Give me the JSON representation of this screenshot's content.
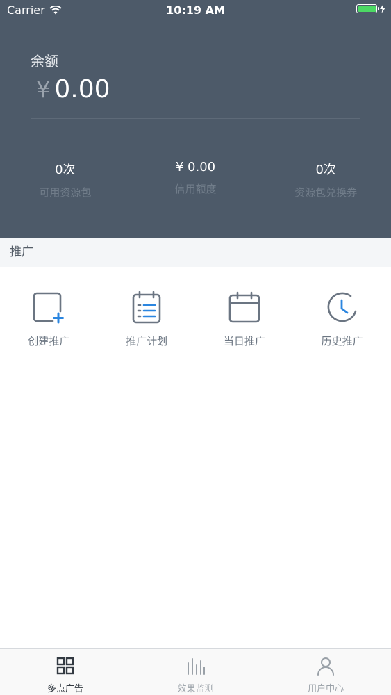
{
  "status_bar": {
    "carrier": "Carrier",
    "time": "10:19 AM",
    "battery_color": "#4cd964"
  },
  "header": {
    "balance_label": "余额",
    "currency_symbol": "¥",
    "balance_value": "0.00",
    "background": "#4d5a69",
    "stats": [
      {
        "value": "0次",
        "label": "可用资源包"
      },
      {
        "value": "¥ 0.00",
        "label": "信用额度"
      },
      {
        "value": "0次",
        "label": "资源包兑换券"
      }
    ]
  },
  "section": {
    "title": "推广"
  },
  "actions": [
    {
      "label": "创建推广",
      "icon": "create-promotion-icon"
    },
    {
      "label": "推广计划",
      "icon": "promotion-plan-icon"
    },
    {
      "label": "当日推广",
      "icon": "calendar-icon"
    },
    {
      "label": "历史推广",
      "icon": "clock-icon"
    }
  ],
  "tabbar": {
    "tabs": [
      {
        "label": "多点广告",
        "icon": "grid-icon",
        "active": true
      },
      {
        "label": "效果监测",
        "icon": "bar-chart-icon",
        "active": false
      },
      {
        "label": "用户中心",
        "icon": "user-icon",
        "active": false
      }
    ]
  },
  "colors": {
    "accent": "#2b86e0",
    "icon_gray": "#6b7582"
  }
}
